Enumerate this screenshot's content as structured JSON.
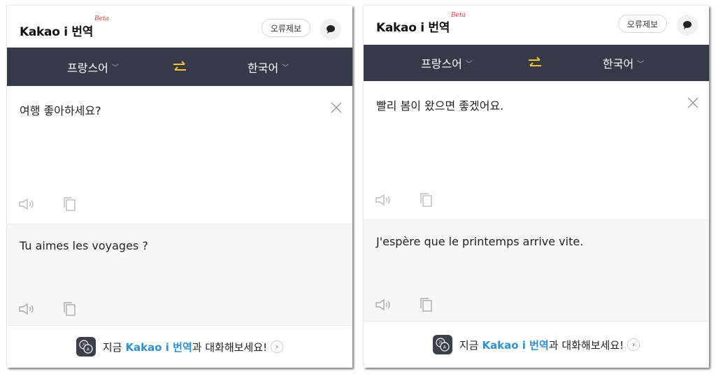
{
  "app": {
    "logo": "Kakao i 번역",
    "beta": "Beta",
    "report_label": "오류제보",
    "chat_icon": "chat-bubble-icon"
  },
  "colors": {
    "lang_bar": "#363a48",
    "swap_accent": "#f2c12e",
    "brand_blue": "#2f8fd5",
    "beta_red": "#e03b3b"
  },
  "left": {
    "source_lang": "프랑스어",
    "target_lang": "한국어",
    "source_text": "여행 좋아하세요?",
    "target_text": "Tu aimes les voyages ?"
  },
  "right": {
    "source_lang": "프랑스어",
    "target_lang": "한국어",
    "source_text": "빨리 봄이 왔으면 좋겠어요.",
    "target_text": "J'espère que le printemps arrive vite."
  },
  "footer": {
    "pre": "지금",
    "brand": "Kakao i 번역",
    "post": "과 대화해보세요!",
    "arrow": "›"
  },
  "icons": {
    "speaker": "speaker-icon",
    "copy": "copy-icon",
    "clear": "close-icon",
    "swap": "swap-arrows-icon",
    "chevron": "chevron-down-icon"
  }
}
